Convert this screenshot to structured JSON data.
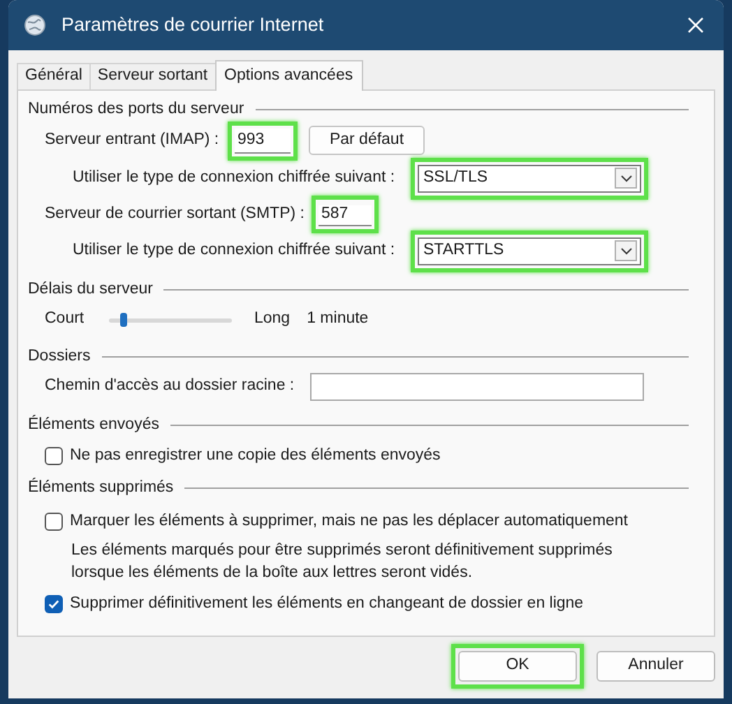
{
  "window": {
    "title": "Paramètres de courrier Internet"
  },
  "tabs": [
    {
      "label": "Général",
      "selected": false
    },
    {
      "label": "Serveur sortant",
      "selected": false
    },
    {
      "label": "Options avancées",
      "selected": true
    }
  ],
  "ports": {
    "title": "Numéros des ports du serveur",
    "incoming": {
      "label": "Serveur entrant (IMAP) :",
      "value": "993",
      "highlighted": true
    },
    "default_button": "Par défaut",
    "incoming_encryption": {
      "label": "Utiliser le type de connexion chiffrée suivant :",
      "value": "SSL/TLS",
      "highlighted": true
    },
    "outgoing": {
      "label": "Serveur de courrier sortant (SMTP) :",
      "value": "587",
      "highlighted": true
    },
    "outgoing_encryption": {
      "label": "Utiliser le type de connexion chiffrée suivant :",
      "value": "STARTTLS",
      "highlighted": true
    }
  },
  "timeout": {
    "title": "Délais du serveur",
    "min_label": "Court",
    "max_label": "Long",
    "level": 0.1,
    "reading": "1 minute"
  },
  "folders": {
    "title": "Dossiers",
    "root_label": "Chemin d'accès au dossier racine :"
  },
  "sent": {
    "title": "Éléments envoyés",
    "options": [
      {
        "label": "Ne pas enregistrer une copie des éléments envoyés",
        "checked": false
      }
    ]
  },
  "deleted": {
    "title": "Éléments supprimés",
    "options": [
      {
        "label": "Marquer les éléments à supprimer, mais ne pas les déplacer automatiquement",
        "checked": false,
        "note": "Les éléments marqués pour être supprimés seront définitivement supprimés lorsque les éléments de la boîte aux lettres seront vidés."
      },
      {
        "label": "Supprimer définitivement les éléments en changeant de dossier en ligne",
        "checked": true
      }
    ]
  },
  "buttons": [
    {
      "label": "OK",
      "highlighted": true
    },
    {
      "label": "Annuler",
      "highlighted": false
    }
  ]
}
